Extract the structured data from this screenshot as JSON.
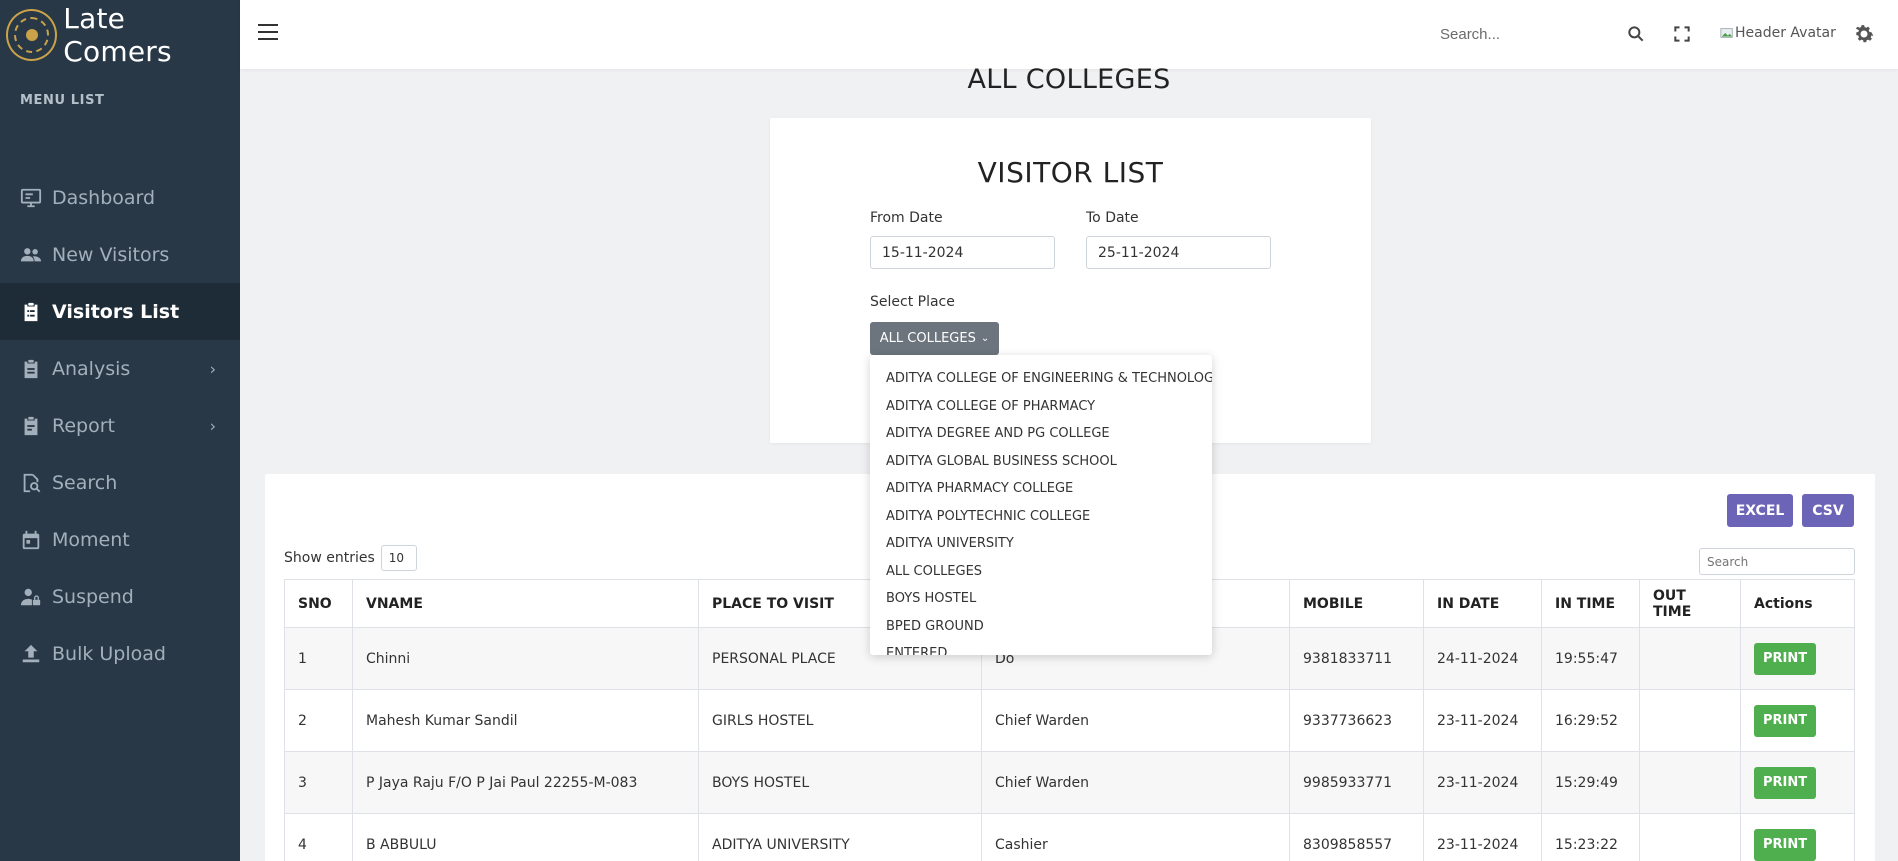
{
  "app": {
    "title": "Late Comers"
  },
  "sidebar": {
    "menu_label": "MENU LIST",
    "items": [
      {
        "label": "Dashboard",
        "icon": "monitor-icon"
      },
      {
        "label": "New Visitors",
        "icon": "users-icon"
      },
      {
        "label": "Visitors List",
        "icon": "clipboard-list-icon",
        "active": true
      },
      {
        "label": "Analysis",
        "icon": "clipboard-icon",
        "chevron": "›"
      },
      {
        "label": "Report",
        "icon": "clipboard-report-icon",
        "chevron": "›"
      },
      {
        "label": "Search",
        "icon": "search-doc-icon"
      },
      {
        "label": "Moment",
        "icon": "calendar-icon"
      },
      {
        "label": "Suspend",
        "icon": "user-lock-icon"
      },
      {
        "label": "Bulk Upload",
        "icon": "upload-icon"
      }
    ]
  },
  "header": {
    "search_placeholder": "Search...",
    "avatar_alt": "Header Avatar"
  },
  "page": {
    "title": "ALL COLLEGES"
  },
  "filter": {
    "title": "VISITOR LIST",
    "from_label": "From Date",
    "from_value": "15-11-2024",
    "to_label": "To Date",
    "to_value": "25-11-2024",
    "place_label": "Select Place",
    "place_value": "ALL COLLEGES",
    "options": [
      "ADITYA COLLEGE OF ENGINEERING & TECHNOLOGY",
      "ADITYA COLLEGE OF PHARMACY",
      "ADITYA DEGREE AND PG COLLEGE",
      "ADITYA GLOBAL BUSINESS SCHOOL",
      "ADITYA PHARMACY COLLEGE",
      "ADITYA POLYTECHNIC COLLEGE",
      "ADITYA UNIVERSITY",
      "ALL COLLEGES",
      "BOYS HOSTEL",
      "BPED GROUND",
      "ENTERED"
    ]
  },
  "table": {
    "excel_label": "EXCEL",
    "csv_label": "CSV",
    "show_entries_label": "Show entries",
    "entries_value": "10",
    "search_placeholder": "Search",
    "headers": [
      "SNO",
      "VNAME",
      "PLACE TO VISIT",
      "",
      "MOBILE",
      "IN DATE",
      "IN TIME",
      "OUT TIME",
      "Actions"
    ],
    "rows": [
      {
        "sno": "1",
        "vname": "Chinni",
        "place": "PERSONAL PLACE",
        "person": "Do",
        "mobile": "9381833711",
        "in_date": "24-11-2024",
        "in_time": "19:55:47",
        "out_time": ""
      },
      {
        "sno": "2",
        "vname": "Mahesh Kumar Sandil",
        "place": "GIRLS HOSTEL",
        "person": "Chief Warden",
        "mobile": "9337736623",
        "in_date": "23-11-2024",
        "in_time": "16:29:52",
        "out_time": ""
      },
      {
        "sno": "3",
        "vname": "P Jaya Raju F/O P Jai Paul 22255-M-083",
        "place": "BOYS HOSTEL",
        "person": "Chief Warden",
        "mobile": "9985933771",
        "in_date": "23-11-2024",
        "in_time": "15:29:49",
        "out_time": ""
      },
      {
        "sno": "4",
        "vname": "B ABBULU",
        "place": "ADITYA UNIVERSITY",
        "person": "Cashier",
        "mobile": "8309858557",
        "in_date": "23-11-2024",
        "in_time": "15:23:22",
        "out_time": ""
      }
    ],
    "print_label": "PRINT"
  }
}
